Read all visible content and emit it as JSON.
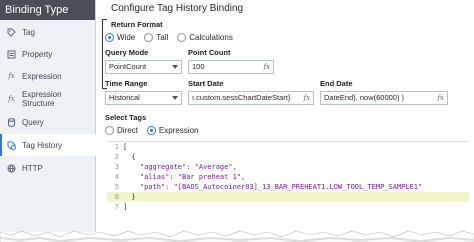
{
  "sidebar": {
    "header": "Binding Type",
    "items": [
      {
        "label": "Tag",
        "icon": "tag-icon"
      },
      {
        "label": "Property",
        "icon": "property-icon"
      },
      {
        "label": "Expression",
        "icon": "fx-icon"
      },
      {
        "label": "Expression Structure",
        "icon": "fx-icon"
      },
      {
        "label": "Query",
        "icon": "database-icon"
      },
      {
        "label": "Tag History",
        "icon": "tag-history-icon",
        "active": true
      },
      {
        "label": "HTTP",
        "icon": "http-icon"
      }
    ]
  },
  "main": {
    "title": "Configure Tag History Binding",
    "return_format": {
      "label": "Return Format",
      "options": [
        "Wide",
        "Tall",
        "Calculations"
      ],
      "selected": "Wide"
    },
    "query_mode": {
      "label": "Query Mode",
      "value": "PointCount"
    },
    "point_count": {
      "label": "Point Count",
      "value": "100"
    },
    "time_range": {
      "label": "Time Range",
      "value": "Historical"
    },
    "start_date": {
      "label": "Start Date",
      "value": "ı.custom.sessChartDateStart}"
    },
    "end_date": {
      "label": "End Date",
      "value": "DateEnd},      now(60000) )"
    },
    "fx_label": "fx",
    "select_tags": {
      "label": "Select Tags",
      "options": [
        "Direct",
        "Expression"
      ],
      "selected": "Expression"
    },
    "code_lines": [
      {
        "n": "1",
        "text": "["
      },
      {
        "n": "2",
        "text": "  {"
      },
      {
        "n": "3",
        "text": "    \"aggregate\": \"Average\","
      },
      {
        "n": "4",
        "text": "    \"alias\": \"Bar preheat 1\","
      },
      {
        "n": "5",
        "text": "    \"path\": \"[BAOS_Autocoiner03]_13_BAR_PREHEAT1.LOW_TOOL_TEMP_SAMPLE1\""
      },
      {
        "n": "6",
        "text": "  }"
      },
      {
        "n": "7",
        "text": "]"
      }
    ]
  },
  "colors": {
    "accent": "#2a7de1",
    "sidebar_bg": "#eef1f5",
    "header_bg": "#4a4f57",
    "string": "#7a1f9a",
    "highlight_line": "#f4f6c8"
  }
}
